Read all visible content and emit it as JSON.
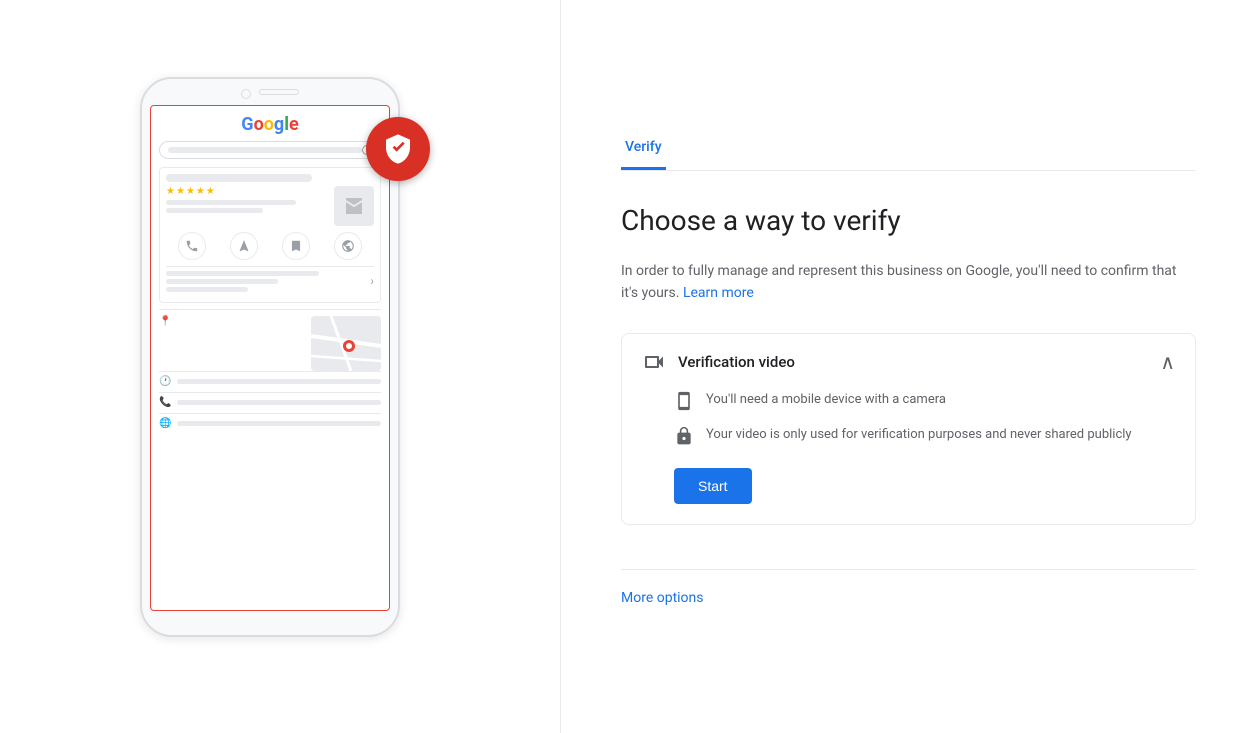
{
  "tab": {
    "label": "Verify"
  },
  "heading": "Choose a way to verify",
  "description": {
    "text": "In order to fully manage and represent this business on Google, you'll need to confirm that it's yours.",
    "learn_more": "Learn more"
  },
  "verification": {
    "title": "Verification video",
    "detail_1": "You'll need a mobile device with a camera",
    "detail_2": "Your video is only used for verification purposes and never shared publicly",
    "start_button": "Start"
  },
  "more_options": "More options",
  "phone_illustration": {
    "google_letters": [
      "G",
      "o",
      "o",
      "g",
      "l",
      "e"
    ],
    "stars": [
      "★",
      "★",
      "★",
      "★",
      "★"
    ]
  }
}
